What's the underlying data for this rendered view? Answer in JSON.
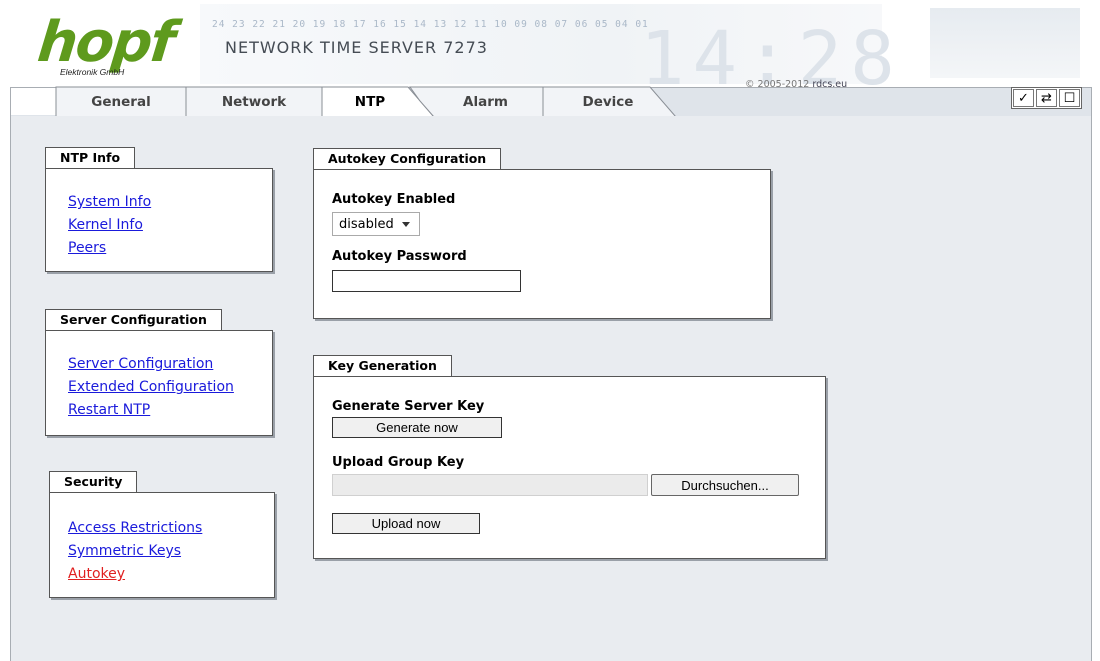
{
  "header": {
    "logo_text": "hopf",
    "logo_subtitle": "Elektronik   GmbH",
    "digit_strip": "24 23 22 21 20 19 18 17 16 15 14 13 12 11 10 09 08 07 06 05 04 01",
    "product_title": "NETWORK TIME SERVER 7273",
    "background_clock": "14:28",
    "copyright_prefix": "© 2005-2012",
    "copyright_link": "rdcs.eu"
  },
  "tabs": [
    {
      "label": "General",
      "active": false
    },
    {
      "label": "Network",
      "active": false
    },
    {
      "label": "NTP",
      "active": true
    },
    {
      "label": "Alarm",
      "active": false
    },
    {
      "label": "Device",
      "active": false
    }
  ],
  "toolbar": {
    "apply_icon": "check-icon",
    "apply_glyph": "✓",
    "reload_icon": "reload-icon",
    "reload_glyph": "⇄",
    "save_icon": "save-icon",
    "save_glyph": "☐"
  },
  "sidebar": {
    "ntp_info": {
      "title": "NTP Info",
      "links": [
        "System Info",
        "Kernel Info",
        "Peers"
      ]
    },
    "server_configuration": {
      "title": "Server Configuration",
      "links": [
        "Server Configuration",
        "Extended Configuration",
        "Restart NTP"
      ]
    },
    "security": {
      "title": "Security",
      "links": [
        "Access Restrictions",
        "Symmetric Keys",
        "Autokey"
      ],
      "current": "Autokey"
    }
  },
  "autokey_config": {
    "title": "Autokey Configuration",
    "enabled_label": "Autokey Enabled",
    "enabled_value": "disabled",
    "password_label": "Autokey Password",
    "password_value": ""
  },
  "key_generation": {
    "title": "Key Generation",
    "generate_label": "Generate Server Key",
    "generate_button": "Generate now",
    "upload_label": "Upload Group Key",
    "file_value": "",
    "browse_button": "Durchsuchen...",
    "upload_button": "Upload now"
  },
  "colors": {
    "link": "#1a1adb",
    "link_current": "#e02020",
    "logo_green": "#5e9a1d",
    "content_bg": "#e9ecf0"
  }
}
